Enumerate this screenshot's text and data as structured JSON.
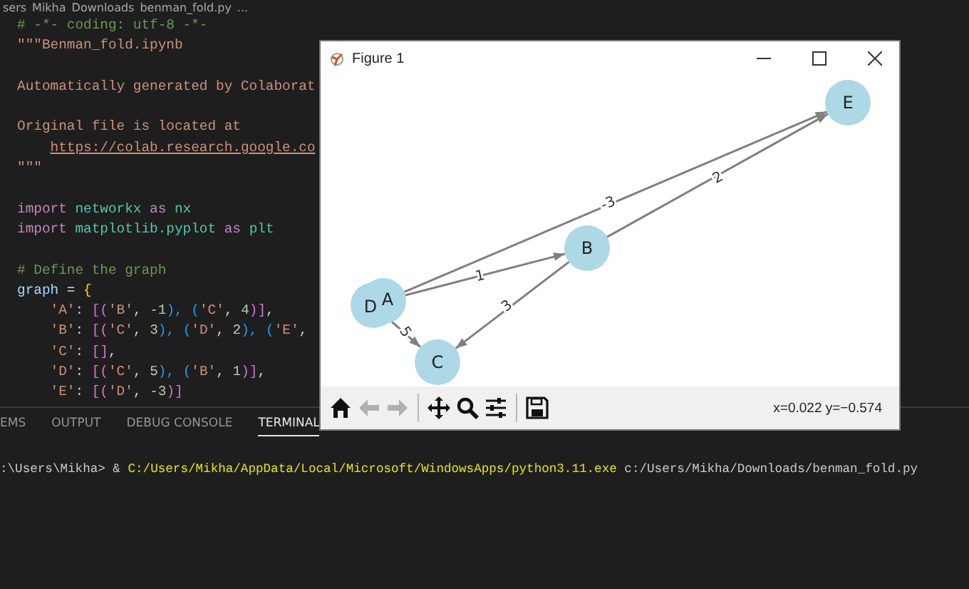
{
  "breadcrumb": [
    "sers",
    "Mikha",
    "Downloads",
    "benman_fold.py",
    "..."
  ],
  "code_lines": [
    {
      "tokens": [
        {
          "text": "# -*- coding: utf-8 -*-",
          "kind": "comment"
        }
      ]
    },
    {
      "tokens": [
        {
          "text": "\"\"\"Benman_fold.ipynb",
          "kind": "string"
        }
      ]
    },
    {
      "blank_before": true,
      "tokens": [
        {
          "text": "Automatically generated by Colaborat",
          "kind": "string"
        }
      ]
    },
    {
      "blank_before": true,
      "tokens": [
        {
          "text": "Original file is located at",
          "kind": "string"
        }
      ]
    },
    {
      "tokens": [
        {
          "text": "https://colab.research.google.co",
          "kind": "link"
        }
      ]
    },
    {
      "tokens": [
        {
          "text": "\"\"\"",
          "kind": "string"
        }
      ]
    },
    {
      "blank_before": true,
      "tokens": [
        {
          "text": "import",
          "kind": "keyword"
        },
        {
          "text": " networkx ",
          "kind": "module"
        },
        {
          "text": "as",
          "kind": "keyword"
        },
        {
          "text": " nx",
          "kind": "module"
        }
      ]
    },
    {
      "tokens": [
        {
          "text": "import",
          "kind": "keyword"
        },
        {
          "text": " matplotlib.pyplot ",
          "kind": "module"
        },
        {
          "text": "as",
          "kind": "keyword"
        },
        {
          "text": " plt",
          "kind": "module"
        }
      ]
    },
    {
      "blank_before": true,
      "tokens": [
        {
          "text": "# Define the graph",
          "kind": "comment"
        }
      ]
    },
    {
      "tokens": [
        {
          "text": "graph",
          "kind": "variable"
        },
        {
          "text": " = ",
          "kind": "plain"
        },
        {
          "text": "{",
          "kind": "bracket"
        }
      ]
    },
    {
      "tokens": [
        {
          "text": "    'A'",
          "kind": "string"
        },
        {
          "text": ": ",
          "kind": "plain"
        },
        {
          "text": "[(",
          "kind": "bracket2"
        },
        {
          "text": "'B'",
          "kind": "string"
        },
        {
          "text": ", ",
          "kind": "plain"
        },
        {
          "text": "-1",
          "kind": "number"
        },
        {
          "text": "), (",
          "kind": "bracket3"
        },
        {
          "text": "'C'",
          "kind": "string"
        },
        {
          "text": ", ",
          "kind": "plain"
        },
        {
          "text": "4",
          "kind": "number"
        },
        {
          "text": ")]",
          "kind": "bracket2"
        },
        {
          "text": ",",
          "kind": "plain"
        }
      ]
    },
    {
      "tokens": [
        {
          "text": "    'B'",
          "kind": "string"
        },
        {
          "text": ": ",
          "kind": "plain"
        },
        {
          "text": "[(",
          "kind": "bracket2"
        },
        {
          "text": "'C'",
          "kind": "string"
        },
        {
          "text": ", ",
          "kind": "plain"
        },
        {
          "text": "3",
          "kind": "number"
        },
        {
          "text": "), (",
          "kind": "bracket3"
        },
        {
          "text": "'D'",
          "kind": "string"
        },
        {
          "text": ", ",
          "kind": "plain"
        },
        {
          "text": "2",
          "kind": "number"
        },
        {
          "text": "), (",
          "kind": "bracket3"
        },
        {
          "text": "'E'",
          "kind": "string"
        },
        {
          "text": ", ",
          "kind": "plain"
        }
      ]
    },
    {
      "tokens": [
        {
          "text": "    'C'",
          "kind": "string"
        },
        {
          "text": ": ",
          "kind": "plain"
        },
        {
          "text": "[]",
          "kind": "bracket2"
        },
        {
          "text": ",",
          "kind": "plain"
        }
      ]
    },
    {
      "tokens": [
        {
          "text": "    'D'",
          "kind": "string"
        },
        {
          "text": ": ",
          "kind": "plain"
        },
        {
          "text": "[(",
          "kind": "bracket2"
        },
        {
          "text": "'C'",
          "kind": "string"
        },
        {
          "text": ", ",
          "kind": "plain"
        },
        {
          "text": "5",
          "kind": "number"
        },
        {
          "text": "), (",
          "kind": "bracket3"
        },
        {
          "text": "'B'",
          "kind": "string"
        },
        {
          "text": ", ",
          "kind": "plain"
        },
        {
          "text": "1",
          "kind": "number"
        },
        {
          "text": ")]",
          "kind": "bracket2"
        },
        {
          "text": ",",
          "kind": "plain"
        }
      ]
    },
    {
      "tokens": [
        {
          "text": "    'E'",
          "kind": "string"
        },
        {
          "text": ": ",
          "kind": "plain"
        },
        {
          "text": "[(",
          "kind": "bracket2"
        },
        {
          "text": "'D'",
          "kind": "string"
        },
        {
          "text": ", ",
          "kind": "plain"
        },
        {
          "text": "-3",
          "kind": "number"
        },
        {
          "text": ")]",
          "kind": "bracket2"
        }
      ]
    }
  ],
  "figure": {
    "title": "Figure 1",
    "nodes": [
      {
        "label": "E"
      },
      {
        "label": "B"
      },
      {
        "label": "D"
      },
      {
        "label": "A"
      },
      {
        "label": "C"
      }
    ],
    "edges": [
      {
        "label": "-3"
      },
      {
        "label": "2"
      },
      {
        "label": "1"
      },
      {
        "label": "3"
      },
      {
        "label": "5"
      }
    ],
    "toolbar": [
      {
        "kind": "home",
        "disabled": false
      },
      {
        "kind": "back",
        "disabled": true
      },
      {
        "kind": "forward",
        "disabled": true
      },
      {
        "kind": "pan",
        "disabled": false
      },
      {
        "kind": "zoom",
        "disabled": false
      },
      {
        "kind": "configure",
        "disabled": false
      },
      {
        "kind": "save",
        "disabled": false
      }
    ],
    "coordinates": "x=0.022 y=−0.574"
  },
  "panel_tabs": [
    {
      "label": "EMS",
      "selected": false
    },
    {
      "label": "OUTPUT",
      "selected": false
    },
    {
      "label": "DEBUG CONSOLE",
      "selected": false
    },
    {
      "label": "TERMINAL",
      "selected": true
    }
  ],
  "terminal_line": [
    {
      "text": ":\\Users\\Mikha> & ",
      "kind": "prompt"
    },
    {
      "text": "C:/Users/Mikha/AppData/Local/Microsoft/WindowsApps/python3.11.exe",
      "kind": "command"
    },
    {
      "text": " c:/Users/Mikha/Downloads/benman_fold.py",
      "kind": "argument"
    }
  ]
}
